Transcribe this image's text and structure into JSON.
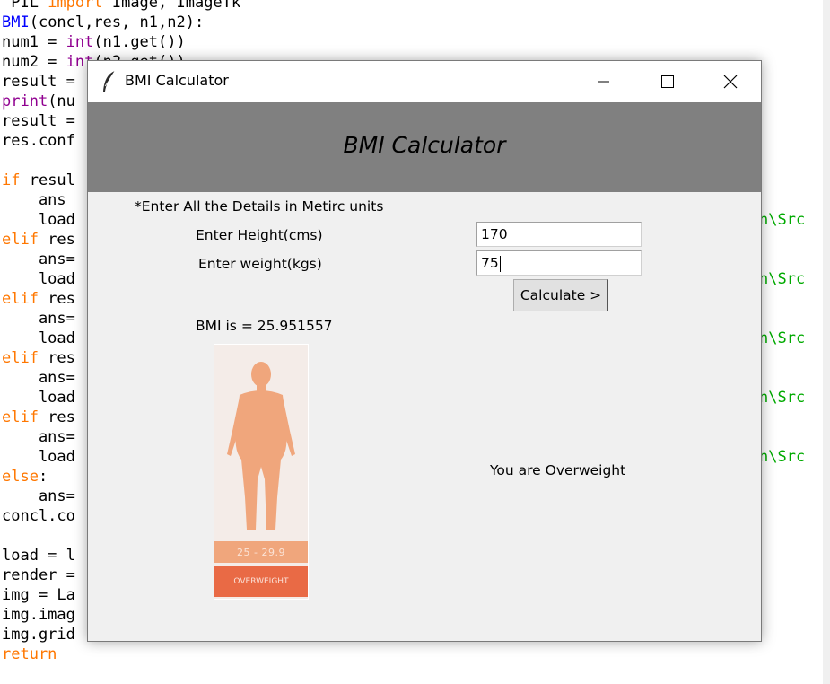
{
  "editor": {
    "line1": {
      "prefix": " PIL ",
      "kw": "import",
      "rest": " Image, ImageTk"
    },
    "line2": {
      "fn": "BMI",
      "rest": "(concl,res, n1,n2):"
    },
    "line3": {
      "a": "num1 = ",
      "bi": "int",
      "b": "(n1.get())"
    },
    "line4": {
      "a": "num2 = ",
      "bi": "int",
      "b": "(n2.get())"
    },
    "line5": "result = ",
    "line6": {
      "bi": "print",
      "rest": "(nu"
    },
    "line7": "result = ",
    "line8": "res.conf",
    "line9": {
      "kw": "if",
      "rest": " resul"
    },
    "line10": "    ans",
    "line11": "    load",
    "line12": {
      "kw": "elif",
      "rest": " res"
    },
    "line13": "    ans=",
    "line14": "    load",
    "line15": {
      "kw": "elif",
      "rest": " res"
    },
    "line16": "    ans=",
    "line17": "    load",
    "line18": {
      "kw": "elif",
      "rest": " res"
    },
    "line19": "    ans=",
    "line20": "    load",
    "line21": {
      "kw": "elif",
      "rest": " res"
    },
    "line22": "    ans=",
    "line23": "    load",
    "line24": {
      "kw": "else",
      "rest": ":"
    },
    "line25": "    ans=",
    "line26": "concl.co",
    "line27": "load = l",
    "line28": "render =",
    "line29": "img = La",
    "line30": "img.imag",
    "line31": "img.grid",
    "line32": {
      "kw": "return"
    },
    "right_fragment": "n\\Src"
  },
  "window": {
    "title": "BMI Calculator",
    "icon": "feather-icon"
  },
  "banner": {
    "title": "BMI Calculator"
  },
  "form": {
    "instruction": "*Enter All the Details in Metirc units",
    "height_label": "Enter Height(cms)",
    "height_value": "170",
    "weight_label": "Enter weight(kgs)",
    "weight_value": "75",
    "calculate_label": "Calculate >"
  },
  "result": {
    "bmi_text": "BMI is = 25.951557",
    "status_text": "You are Overweight"
  },
  "bmi_image": {
    "range": "25 - 29.9",
    "category": "OVERWEIGHT",
    "figure_color": "#f0a67c",
    "category_color": "#e96a45"
  }
}
